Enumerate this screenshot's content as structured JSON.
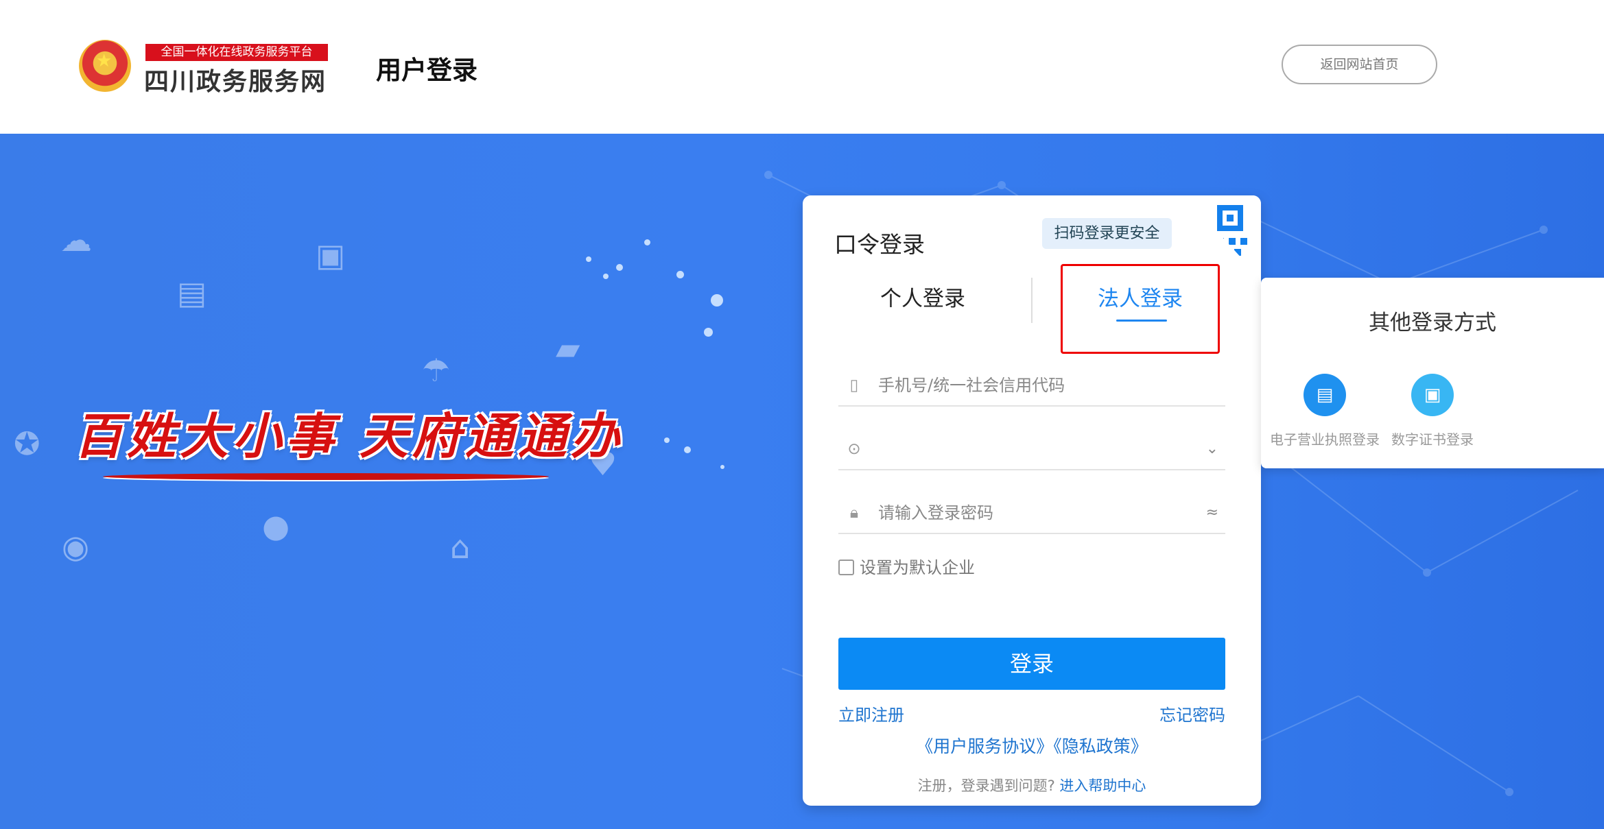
{
  "header": {
    "logo_top": "全国一体化在线政务服务平台",
    "logo_main": "四川政务服务网",
    "title": "用户登录",
    "return_button": "返回网站首页"
  },
  "banner": {
    "slogan": "百姓大小事  天府通通办"
  },
  "login": {
    "title": "口令登录",
    "qr_tip": "扫码登录更安全",
    "tabs": [
      {
        "label": "个人登录",
        "active": false
      },
      {
        "label": "法人登录",
        "active": true
      }
    ],
    "phone_placeholder": "手机号/统一社会信用代码",
    "company_select_value": "",
    "password_placeholder": "请输入登录密码",
    "default_company_label": "设置为默认企业",
    "login_button": "登录",
    "register_link": "立即注册",
    "forgot_link": "忘记密码",
    "agreements": "《用户服务协议》《隐私政策》",
    "help_prefix": "注册，登录遇到问题?",
    "help_link": "进入帮助中心",
    "colors": {
      "primary": "#0b8af4",
      "link": "#1e74cf",
      "highlight_box": "#ee0000"
    }
  },
  "other_login": {
    "title": "其他登录方式",
    "options": [
      {
        "label": "电子营业执照登录",
        "icon": "business-license-icon",
        "color": "#1f91ef"
      },
      {
        "label": "数字证书登录",
        "icon": "digital-certificate-icon",
        "color": "#38b6f3"
      }
    ]
  }
}
